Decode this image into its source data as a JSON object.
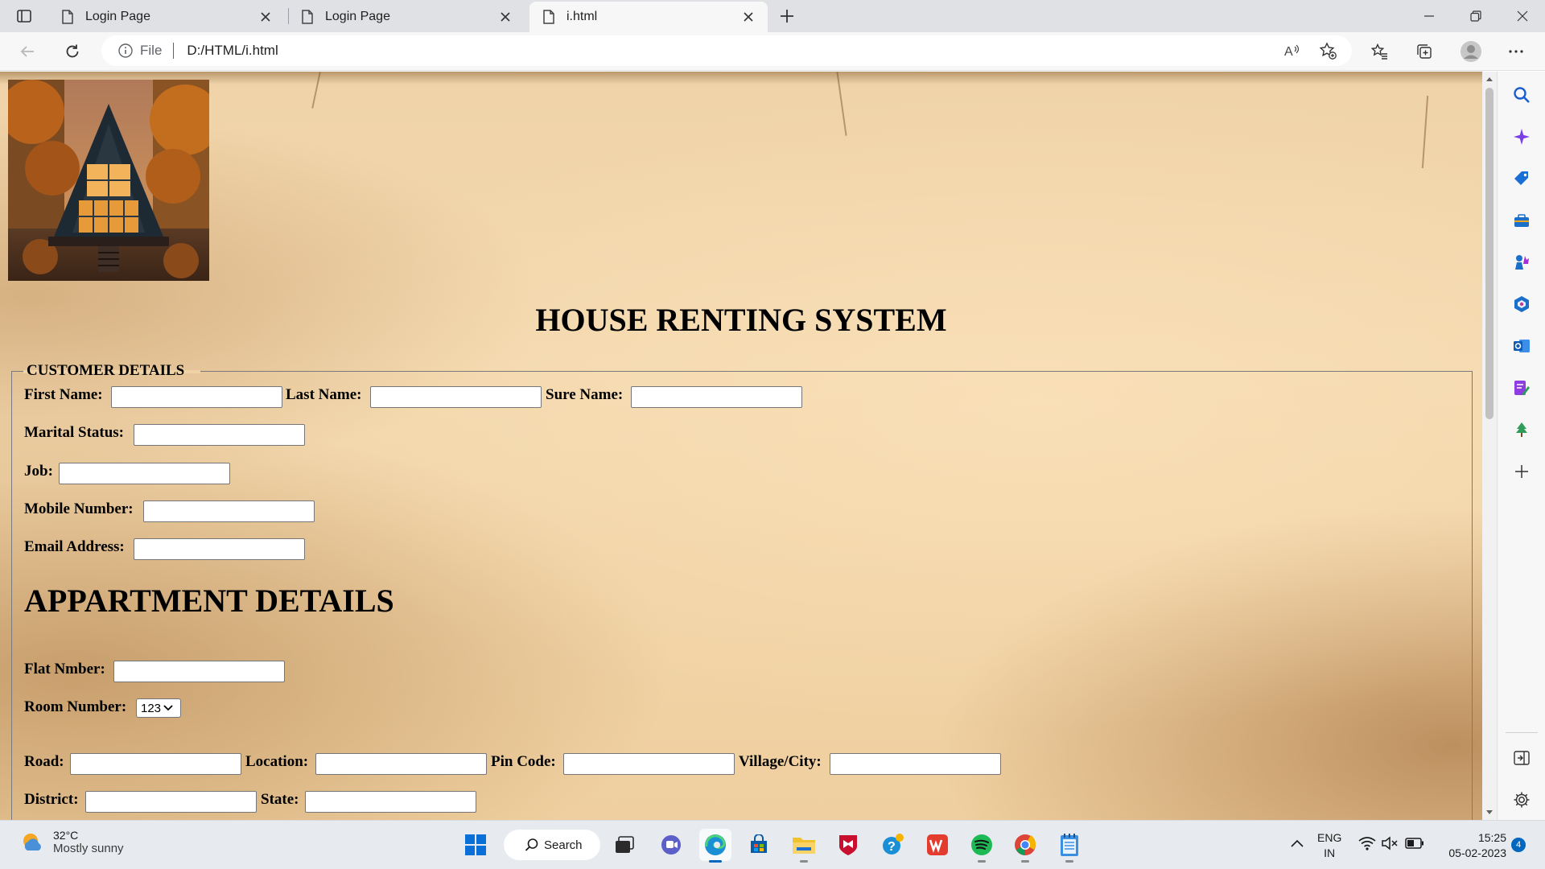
{
  "browser": {
    "tabs": [
      {
        "title": "Login Page",
        "active": false
      },
      {
        "title": "Login Page",
        "active": false
      },
      {
        "title": "i.html",
        "active": true
      }
    ],
    "address": {
      "site_info_label": "File",
      "url": "D:/HTML/i.html"
    }
  },
  "page": {
    "heading": "HOUSE RENTING SYSTEM",
    "customer_section": {
      "legend": "CUSTOMER DETAILS",
      "fields": {
        "first_name": "First Name:",
        "last_name": "Last Name:",
        "sure_name": "Sure Name:",
        "marital_status": "Marital Status:",
        "job": "Job:",
        "mobile_number": "Mobile Number:",
        "email_address": "Email Address:"
      }
    },
    "apartment_section": {
      "heading": "APPARTMENT DETAILS",
      "fields": {
        "flat_number": "Flat Nmber:",
        "room_number": "Room Number:",
        "road": "Road:",
        "location": "Location:",
        "pin_code": "Pin Code:",
        "village_city": "Village/City:",
        "district": "District:",
        "state": "State:"
      },
      "room_number_selected": "123"
    }
  },
  "taskbar": {
    "weather": {
      "temp": "32°C",
      "desc": "Mostly sunny"
    },
    "search_label": "Search",
    "lang": {
      "line1": "ENG",
      "line2": "IN"
    },
    "clock": {
      "time": "15:25",
      "date": "05-02-2023"
    },
    "notification_count": "4"
  },
  "colors": {
    "edge_accent": "#0067c0",
    "parchment": "#f3d8ae"
  }
}
